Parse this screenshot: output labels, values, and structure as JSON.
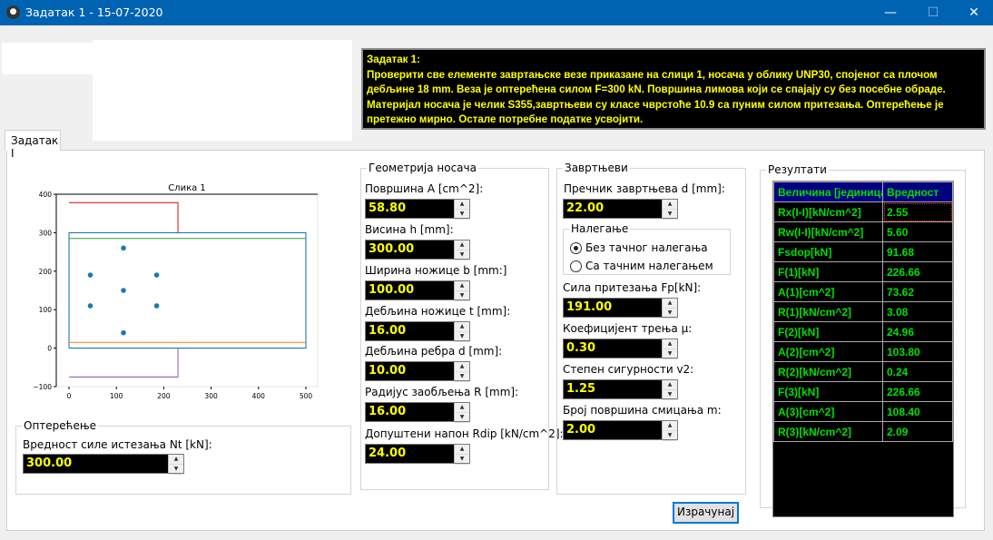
{
  "window": {
    "title": "Задатак 1 - 15-07-2020",
    "minimize": "—",
    "maximize": "☐",
    "close": "✕",
    "icon": "paw-icon"
  },
  "task": {
    "heading": "Задатак 1:",
    "body": "Проверити све елементе завртањске везе приказане на слици 1, носача у облику  UNP30, спојеног са плочом дебљине 18 mm. Веза је оптерећена силом F=300 kN. Површина лимова који се спајају су без посебне обраде. Материјал носача је челик S355,завртњеви су класе чврстоће 10.9 са пуним силом притезања. Оптерећење је претежно мирно. Остале потребне податке усвојити."
  },
  "tab": "Задатак I",
  "chart_data": {
    "type": "line",
    "title": "Слика 1",
    "xlim": [
      0,
      500
    ],
    "ylim": [
      -100,
      400
    ],
    "xticks": [
      "0",
      "100",
      "200",
      "300",
      "400",
      "500"
    ],
    "yticks": [
      "400",
      "300",
      "200",
      "100",
      "0",
      "−100"
    ],
    "lines": [
      {
        "color": "#1f77b4",
        "points": [
          [
            0,
            0
          ],
          [
            500,
            0
          ],
          [
            500,
            300
          ],
          [
            0,
            300
          ],
          [
            0,
            0
          ]
        ]
      },
      {
        "color": "#ff7f0e",
        "points": [
          [
            0,
            15
          ],
          [
            500,
            15
          ]
        ]
      },
      {
        "color": "#2ca02c",
        "points": [
          [
            0,
            285
          ],
          [
            500,
            285
          ]
        ]
      },
      {
        "color": "#d62728",
        "points": [
          [
            0,
            378
          ],
          [
            230,
            378
          ],
          [
            230,
            300
          ]
        ]
      },
      {
        "color": "#9467bd",
        "points": [
          [
            0,
            -75
          ],
          [
            230,
            -75
          ],
          [
            230,
            0
          ]
        ]
      }
    ],
    "bolts": {
      "color": "#1f77b4",
      "points": [
        [
          45,
          190
        ],
        [
          45,
          110
        ],
        [
          115,
          260
        ],
        [
          115,
          150
        ],
        [
          115,
          40
        ],
        [
          185,
          190
        ],
        [
          185,
          110
        ]
      ]
    }
  },
  "load": {
    "legend": "Оптерећење",
    "label": "Вредност силе истезања Nt [kN]:",
    "value": "300.00"
  },
  "geometry": {
    "legend": "Геометрија носача",
    "fields": [
      {
        "label": "Површина A [cm^2]:",
        "value": "58.80"
      },
      {
        "label": "Висина h [mm]:",
        "value": "300.00"
      },
      {
        "label": "Ширина ножице b [mm:]",
        "value": "100.00"
      },
      {
        "label": "Дебљина ножице t [mm]:",
        "value": "16.00"
      },
      {
        "label": "Дебљина ребра d [mm]:",
        "value": "10.00"
      },
      {
        "label": "Радијус заобљења R [mm]:",
        "value": "16.00"
      },
      {
        "label": "Допуштени напон Rdip [kN/cm^2]:",
        "value": "24.00"
      }
    ]
  },
  "bolts": {
    "legend": "Завртњеви",
    "diameter": {
      "label": "Пречник завртњева d [mm]:",
      "value": "22.00"
    },
    "bearing": {
      "legend": "Налегање",
      "options": [
        {
          "label": "Без тачног налегања",
          "selected": true
        },
        {
          "label": "Са тачним налегањем",
          "selected": false
        }
      ]
    },
    "fields": [
      {
        "label": "Сила притезања Fp[kN]:",
        "value": "191.00"
      },
      {
        "label": "Коефицијент трења µ:",
        "value": "0.30"
      },
      {
        "label": "Степен сигурности v2:",
        "value": "1.25"
      },
      {
        "label": "Број површина смицања m:",
        "value": "2.00"
      }
    ]
  },
  "results": {
    "legend": "Резултати",
    "headers": [
      "Величина [јединица]",
      "Вредност"
    ],
    "rows": [
      [
        "Rx(I-I)[kN/cm^2]",
        "2.55"
      ],
      [
        "Rw(I-I)[kN/cm^2]",
        "5.60"
      ],
      [
        "Fsdop[kN]",
        "91.68"
      ],
      [
        "F(1)[kN]",
        "226.66"
      ],
      [
        "A(1)[cm^2]",
        "73.62"
      ],
      [
        "R(1)[kN/cm^2]",
        "3.08"
      ],
      [
        "F(2)[kN]",
        "24.96"
      ],
      [
        "A(2)[cm^2]",
        "103.80"
      ],
      [
        "R(2)[kN/cm^2]",
        "0.24"
      ],
      [
        "F(3)[kN]",
        "226.66"
      ],
      [
        "A(3)[cm^2]",
        "108.40"
      ],
      [
        "R(3)[kN/cm^2]",
        "2.09"
      ]
    ]
  },
  "calculate": "Израчунај"
}
